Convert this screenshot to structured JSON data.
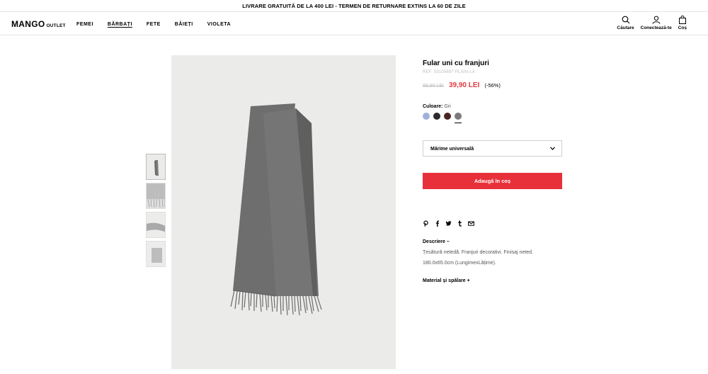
{
  "promo": {
    "text": "LIVRARE GRATUITĂ DE LA 400 LEI - TERMEN DE RETURNARE EXTINS LA 60 DE ZILE"
  },
  "header": {
    "logo": "MANGO",
    "logo_sub": "OUTLET",
    "nav": [
      "FEMEI",
      "BĂRBAȚI",
      "FETE",
      "BĂIEȚI",
      "VIOLETA"
    ],
    "active_nav": "BĂRBAȚI",
    "actions": {
      "search": "Căutare",
      "login": "Conectează-te",
      "cart": "Coș"
    }
  },
  "product": {
    "title": "Fular uni cu franjuri",
    "ref": "REF. 53105687 PLAIN-LA",
    "old_price": "89,90 LEI",
    "price": "39,90 LEI",
    "discount": "(-56%)",
    "color_label": "Culoare:",
    "color_value": "Gri",
    "swatch_colors": [
      "#9fb1d9",
      "#2a2a2a",
      "#4a2520",
      "#7a7a7a"
    ],
    "selected_swatch": 3,
    "size": "Mărime universală",
    "add_to_cart": "Adaugă în coș"
  },
  "share_icons": [
    "pinterest-icon",
    "facebook-icon",
    "twitter-icon",
    "tumblr-icon",
    "email-icon"
  ],
  "description": {
    "title": "Descriere –",
    "line1": "Țesătură netedă. Franjuri decorativi. Finisaj neted.",
    "line2": "180.0x65.0cm (LungimexLățime).",
    "material_title": "Material și spălare +"
  }
}
